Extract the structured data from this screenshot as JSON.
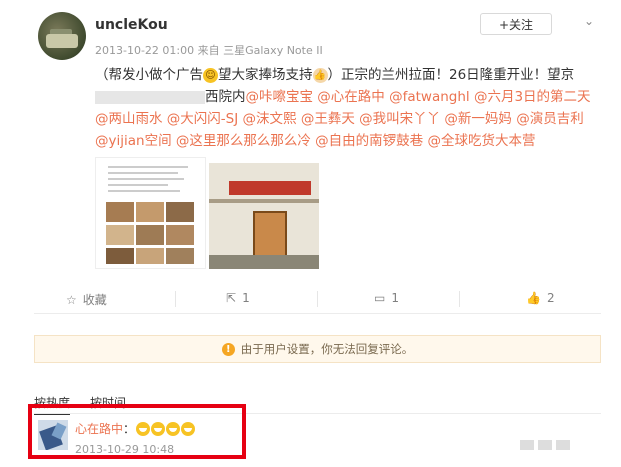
{
  "post": {
    "username": "uncleKou",
    "meta": "2013-10-22 01:00 来自 三星Galaxy Note II",
    "follow_label": "+关注",
    "text_part1": "（帮发小做个广告",
    "text_part2": "望大家捧场支持",
    "text_part3": "）正宗的兰州拉面！26日隆重开业！望京",
    "text_part4": "西院内",
    "mentions": [
      "@咔嚓宝宝",
      "@心在路中",
      "@fatwanghl",
      "@六月3日的第二天",
      "@两山雨水",
      "@大闪闪-SJ",
      "@沫文熙",
      "@王彝天",
      "@我叫宋丫丫",
      "@新一妈妈",
      "@演员吉利",
      "@yijian空间",
      "@这里那么那么那么冷",
      "@自由的南锣鼓巷",
      "@全球吃货大本营"
    ],
    "images": [
      {
        "name": "menu-collage-image"
      },
      {
        "name": "storefront-image"
      }
    ]
  },
  "actions": {
    "favorite": "收藏",
    "repost_count": "1",
    "comment_count": "1",
    "like_count": "2"
  },
  "notice": {
    "text": "由于用户设置，你无法回复评论。"
  },
  "sort": {
    "hot": "按热度",
    "time": "按时间"
  },
  "comment": {
    "author": "心在路中",
    "colon": "：",
    "time": "2013-10-29 10:48"
  },
  "colors": {
    "link": "#eb7350",
    "highlight_box": "#e60012"
  }
}
